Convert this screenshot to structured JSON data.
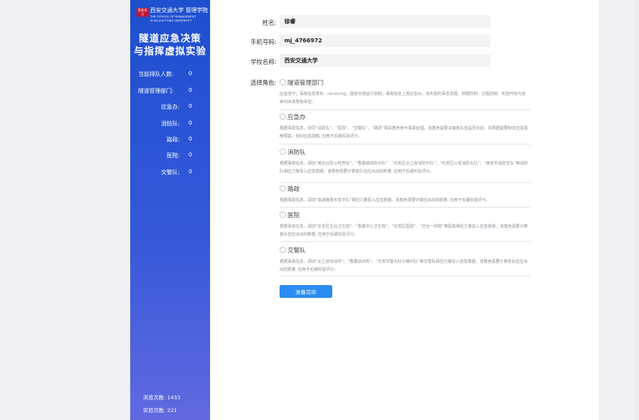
{
  "logo": {
    "badge": "西安交大",
    "chinese": "西安交通大学 管理学院",
    "english_line1": "THE SCHOOL OF MANAGEMENT",
    "english_line2": "XI'AN JIAOTONG UNIVERSITY"
  },
  "sidebar": {
    "title_line1": "隧道应急决策",
    "title_line2": "与指挥虚拟实验",
    "stats": [
      {
        "label": "当前排队人数:",
        "value": "0"
      },
      {
        "label": "隧道管理部门:",
        "value": "0"
      },
      {
        "label": "应急办:",
        "value": "0"
      },
      {
        "label": "消防队:",
        "value": "0"
      },
      {
        "label": "路政:",
        "value": "0"
      },
      {
        "label": "医院:",
        "value": "0"
      },
      {
        "label": "交警队:",
        "value": "0"
      }
    ],
    "visit_count": "浏览次数: 1433",
    "experiment_count": "实验次数: 221"
  },
  "form": {
    "name_label": "姓名:",
    "name_value": "徐睿",
    "phone_label": "手机号码:",
    "phone_value": "mj_4766972",
    "school_label": "学校名称:",
    "school_value": "西安交通大学",
    "role_label": "选择角色:",
    "roles": [
      {
        "name": "隧道管理部门",
        "desc": "应急值守；事故信息发布、receiving；隧道交通运行管制；事故信息上报应急办。该实验的事态发展、规模控制、过程控制、实验开始与结束均由该角色承担。"
      },
      {
        "name": "应急办",
        "desc": "根据事故信息，协同“消防队”、“医院”、“交警队”、“路政”相关角色参与事故处理。该角色需要决策各队伍是否出动、并根据需要制定应急疏散预案，组织应急疏散, 应用于后期实验评分。"
      },
      {
        "name": "消防队",
        "desc": "根据事故信息，调动“南五台防火检查站”、“曹鑫镇消防中队”、“长安区太乙宫消防中队”、“长安区公安消防大队”、“西安市消防支队”等消防队相应力量投入应急救援。该角色需要计算各队伍应派出的数量, 应用于后期实验评分。"
      },
      {
        "name": "路政",
        "desc": "根据事故信息，调动“高速路政长安中队”相应力量投入应急救援。该角色需要计算应派出的数量, 应用于后期实验评分。"
      },
      {
        "name": "医院",
        "desc": "根据事故信息，调动“长安区五台卫生院”、“曹鑫中心卫生院”、“长安区医院”、“交大一附院”等医院相应力量投入应急救援。该角色需要计算各队伍应派出的数量, 应用于后期实验评分。"
      },
      {
        "name": "交警队",
        "desc": "根据事故信息，调动“太乙宫派出所”、“曹鑫派出所”、“长安交警大队引镇中队”等交警队相应力量投入应急救援。该角色需要计算各队伍应派出的数量, 应用于后期实验评分。"
      }
    ],
    "submit_label": "准备完毕"
  },
  "colors": {
    "sidebar_top": "#1e4fcf",
    "sidebar_bottom": "#6169e0",
    "primary_button": "#2b8cf0"
  }
}
